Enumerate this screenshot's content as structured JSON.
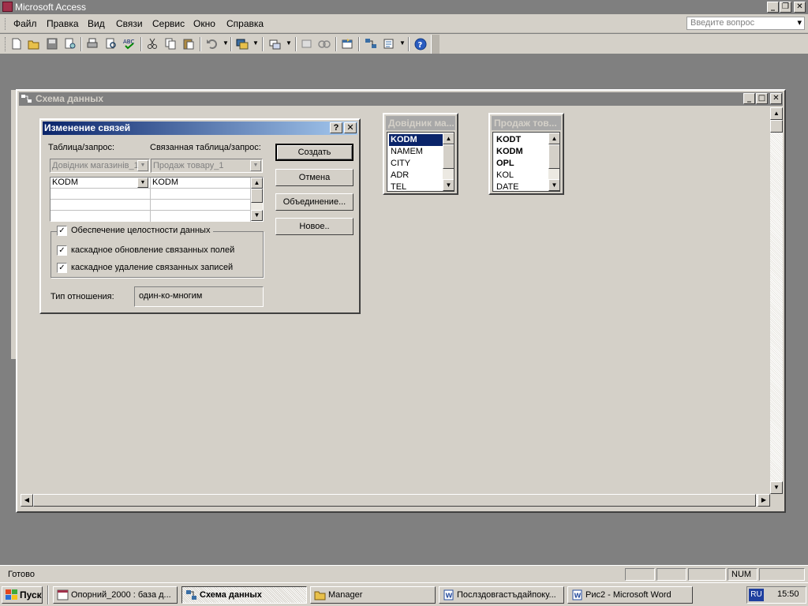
{
  "app": {
    "title": "Microsoft Access"
  },
  "menu": {
    "items": [
      {
        "label": "Файл"
      },
      {
        "label": "Правка"
      },
      {
        "label": "Вид"
      },
      {
        "label": "Связи"
      },
      {
        "label": "Сервис"
      },
      {
        "label": "Окно"
      },
      {
        "label": "Справка"
      }
    ],
    "help_placeholder": "Введите вопрос"
  },
  "toolbar": {
    "icons": [
      "new-icon",
      "open-icon",
      "save-icon",
      "search-file-icon",
      "print-icon",
      "print-preview-icon",
      "spelling-icon",
      "cut-icon",
      "copy-icon",
      "paste-icon",
      "undo-icon",
      "office-links-icon",
      "analyze-icon",
      "clear-layout-icon",
      "show-table-icon",
      "show-direct-icon",
      "show-all-icon",
      "new-object-icon",
      "help-icon"
    ]
  },
  "mdi": {
    "title": "Схема данных"
  },
  "tables": [
    {
      "title": "Довідник ма...",
      "fields": [
        {
          "name": "KODM",
          "selected": true,
          "key": true
        },
        {
          "name": "NAMEM",
          "selected": false,
          "key": false
        },
        {
          "name": "CITY",
          "selected": false,
          "key": false
        },
        {
          "name": "ADR",
          "selected": false,
          "key": false
        },
        {
          "name": "TEL",
          "selected": false,
          "key": false
        }
      ]
    },
    {
      "title": "Продаж тов...",
      "fields": [
        {
          "name": "KODT",
          "selected": false,
          "key": true
        },
        {
          "name": "KODM",
          "selected": false,
          "key": true
        },
        {
          "name": "OPL",
          "selected": false,
          "key": true
        },
        {
          "name": "KOL",
          "selected": false,
          "key": false
        },
        {
          "name": "DATE",
          "selected": false,
          "key": false
        }
      ]
    }
  ],
  "dialog": {
    "title": "Изменение связей",
    "table_label": "Таблица/запрос:",
    "related_label": "Связанная таблица/запрос:",
    "table_value": "Довідник магазинів_1",
    "related_value": "Продаж товару_1",
    "grid": {
      "left_field": "KODM",
      "right_field": "KODM"
    },
    "buttons": {
      "create": "Создать",
      "cancel": "Отмена",
      "join": "Объединение...",
      "new": "Новое.."
    },
    "integrity_label": "Обеспечение целостности данных",
    "cascade_update_label": "каскадное обновление связанных полей",
    "cascade_delete_label": "каскадное удаление связанных записей",
    "integrity_checked": true,
    "cascade_update_checked": true,
    "cascade_delete_checked": true,
    "check_glyph": "✓",
    "reltype_label": "Тип отношения:",
    "reltype_value": "один-ко-многим"
  },
  "status": {
    "text": "Готово",
    "num": "NUM"
  },
  "taskbar": {
    "start": "Пуск",
    "tasks": [
      {
        "label": "Опорний_2000 : база д...",
        "active": false,
        "icon": "access-db-icon"
      },
      {
        "label": "Схема данных",
        "active": true,
        "icon": "relationships-icon"
      },
      {
        "label": "Manager",
        "active": false,
        "icon": "folder-icon"
      },
      {
        "label": "Послздовгастъдайпоку...",
        "active": false,
        "icon": "word-doc-icon"
      },
      {
        "label": "Рис2 - Microsoft Word",
        "active": false,
        "icon": "word-doc-icon"
      }
    ],
    "lang": "RU",
    "clock": "15:50"
  }
}
